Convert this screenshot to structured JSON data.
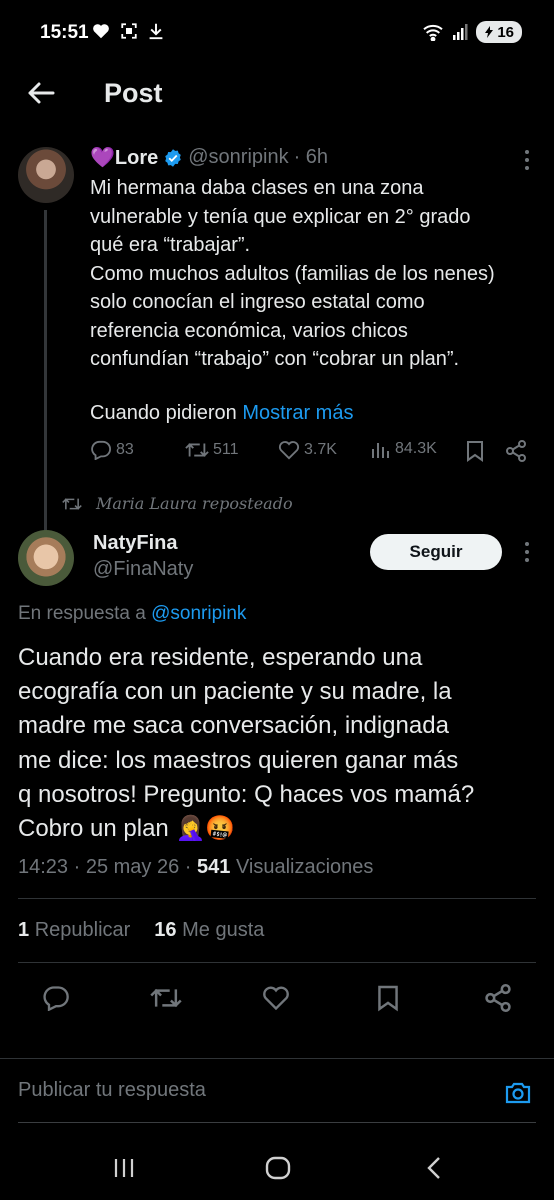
{
  "status_bar": {
    "time": "15:51",
    "battery": "16",
    "icons": [
      "heart-icon",
      "screenshot-icon",
      "download-icon",
      "wifi-icon",
      "signal-icon",
      "battery-icon"
    ]
  },
  "header": {
    "title": "Post"
  },
  "original_post": {
    "name": "💜Lore",
    "handle": "@sonripink",
    "time": "· 6h",
    "lines": [
      "Mi hermana daba clases en una zona",
      "vulnerable y tenía que explicar en 2° grado",
      "qué era “trabajar”.",
      "Como muchos adultos (familias de los nenes)",
      "solo conocían el ingreso estatal como",
      "referencia económica, varios chicos",
      "confundían “trabajo” con “cobrar un plan”."
    ],
    "last_text": "Cuando pidieron",
    "show_more": "Mostrar más",
    "replies": "83",
    "reposts": "511",
    "likes": "3.7K",
    "views": "84.3K"
  },
  "repost_note": "Maria Laura reposteado",
  "reply_post": {
    "name": "NatyFina",
    "handle": "@FinaNaty",
    "follow_label": "Seguir",
    "reply_prefix": "En respuesta a",
    "reply_handle": "@sonripink",
    "lines": [
      "Cuando era residente, esperando una",
      "ecografía con un paciente y su madre, la",
      "madre me saca conversación, indignada",
      "me dice: los maestros quieren ganar más",
      "q nosotros! Pregunto: Q haces vos mamá?",
      "Cobro un plan 🤦‍♀️🤬"
    ],
    "timestamp": "14:23 · 25 may 26 ·",
    "views_count": "541",
    "views_label": "Visualizaciones",
    "reposts_count": "1",
    "reposts_label": "Republicar",
    "likes_count": "16",
    "likes_label": "Me gusta"
  },
  "composer": {
    "placeholder": "Publicar tu respuesta"
  },
  "colors": {
    "accent": "#1d9bf0",
    "background": "#000000",
    "secondary_text": "#71767b"
  }
}
